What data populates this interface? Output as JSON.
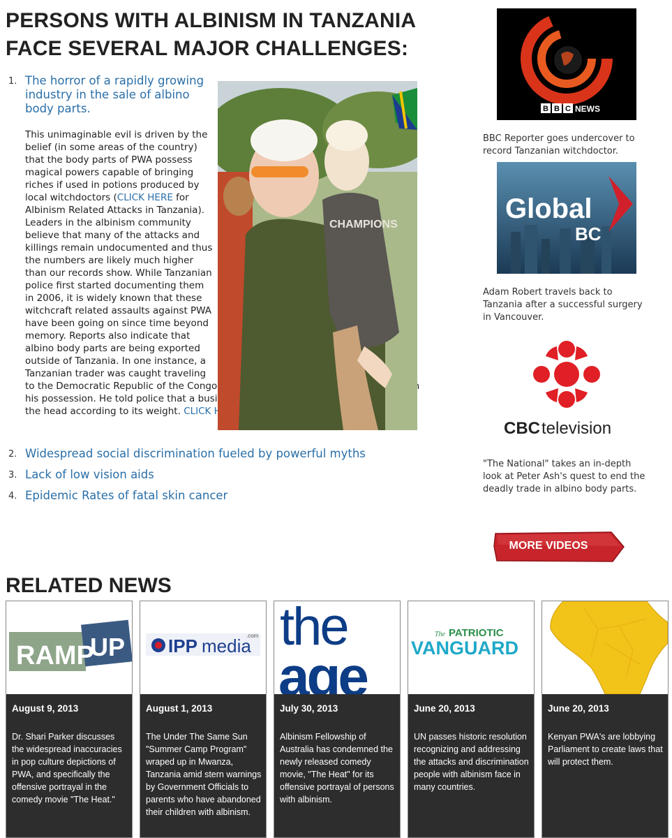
{
  "page": {
    "title": "PERSONS WITH ALBINISM IN TANZANIA FACE SEVERAL MAJOR CHALLENGES:"
  },
  "challenges": [
    {
      "number": "1.",
      "heading": "The horror of a rapidly growing industry in the sale of albino body parts.",
      "body_part1": "This unimaginable evil is driven by the belief (in some areas of the country) that the body parts of PWA possess magical powers capable of bringing riches if used in potions produced by local witchdoctors (",
      "link1": "CLICK HERE",
      "body_part2": " for Albinism Related Attacks in Tanzania). Leaders in the albinism community believe that many of the attacks and killings remain undocumented and thus the numbers are likely much higher than our records show. While Tanzanian police first started documenting them in 2006, it is widely known that these witchcraft related assaults against PWA have been going on since time beyond memory. Reports also indicate that albino body parts are being exported outside of Tanzania. In one instance, a Tanzanian trader was caught traveling to the Democratic Republic of the Congo with the head of an infant with albinism in his possession. He told police that a businessman there was going to pay him for the head according to its weight. ",
      "link2": "CLICK HERE"
    },
    {
      "number": "2.",
      "heading": "Widespread social discrimination fueled by powerful myths"
    },
    {
      "number": "3.",
      "heading": "Lack of low vision aids"
    },
    {
      "number": "4.",
      "heading": "Epidemic Rates of fatal skin cancer"
    }
  ],
  "videos": [
    {
      "logo_text": "BBC NEWS",
      "caption": "BBC Reporter goes undercover to record Tanzanian witchdoctor."
    },
    {
      "logo_text": "Global",
      "logo_sub": "BC",
      "caption": "Adam Robert travels back to Tanzania after a successful surgery in Vancouver."
    },
    {
      "logo_text": "CBCtelevision",
      "caption": "\"The National\" takes an in-depth look at Peter Ash's quest to end the deadly trade in albino body parts."
    }
  ],
  "more_videos_label": "MORE VIDEOS",
  "related": {
    "title": "RELATED NEWS",
    "items": [
      {
        "logo_text": "RAMP UP",
        "date": "August 9, 2013",
        "text": "Dr. Shari Parker discusses the widespread inaccuracies in pop culture depictions of PWA, and specifically the offensive portrayal in the comedy movie \"The Heat.\""
      },
      {
        "logo_text": "IPPmedia",
        "logo_sup": ".com",
        "date": "August 1, 2013",
        "text": "The Under The Same Sun \"Summer Camp Program\" wraped up in Mwanza, Tanzania amid stern warnings by Government Officials to parents who have abandoned their children with albinism."
      },
      {
        "logo_text": "the age",
        "date": "July 30, 2013",
        "text": "Albinism Fellowship of Australia has condemned the newly released comedy movie, \"The Heat\" for its offensive portrayal of persons with albinism."
      },
      {
        "logo_text": "VANGUARD",
        "logo_pre": "The PATRIOTIC",
        "date": "June 20, 2013",
        "text": "UN passes historic resolution recognizing and addressing the attacks and discrimination people with albinism face in many countries."
      },
      {
        "logo_text": "",
        "date": "June 20, 2013",
        "text": "Kenyan PWA's are lobbying Parliament to create laws that will protect them."
      }
    ]
  },
  "colors": {
    "link": "#2a6fa8",
    "button_red": "#c8242b",
    "card_bg": "#2d2d2d",
    "bbc_red": "#e03a1a",
    "cbc_red": "#e01f26"
  }
}
